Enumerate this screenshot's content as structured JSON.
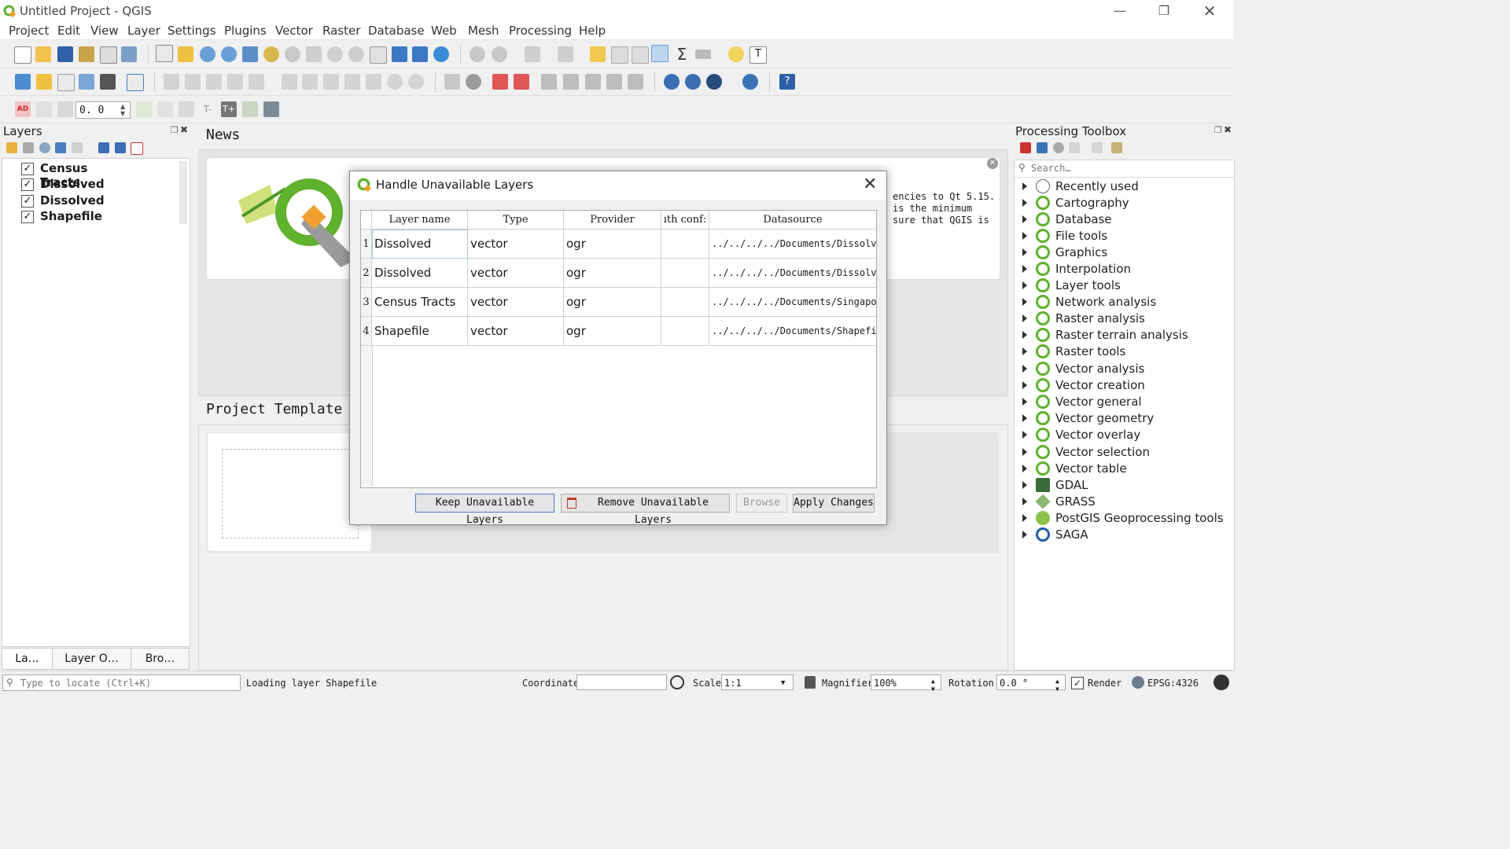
{
  "window": {
    "title": "Untitled Project - QGIS"
  },
  "menu": [
    "Project",
    "Edit",
    "View",
    "Layer",
    "Settings",
    "Plugins",
    "Vector",
    "Raster",
    "Database",
    "Web",
    "Mesh",
    "Processing",
    "Help"
  ],
  "toolbar3": {
    "spin_value": "0. 0"
  },
  "layers_panel": {
    "title": "Layers",
    "layers": [
      {
        "name": "Census Tracts",
        "checked": true
      },
      {
        "name": "Dissolved",
        "checked": true
      },
      {
        "name": "Dissolved",
        "checked": true
      },
      {
        "name": "Shapefile",
        "checked": true
      }
    ],
    "tabs": [
      "La…",
      "Layer O…",
      "Bro…"
    ]
  },
  "center": {
    "news_title": "News",
    "news_text": [
      "encies to Qt 5.15.",
      "is the minimum",
      "sure that QGIS is"
    ],
    "templates_title": "Project Template"
  },
  "toolbox": {
    "title": "Processing Toolbox",
    "search_placeholder": "Search…",
    "items": [
      "Recently used",
      "Cartography",
      "Database",
      "File tools",
      "Graphics",
      "Interpolation",
      "Layer tools",
      "Network analysis",
      "Raster analysis",
      "Raster terrain analysis",
      "Raster tools",
      "Vector analysis",
      "Vector creation",
      "Vector general",
      "Vector geometry",
      "Vector overlay",
      "Vector selection",
      "Vector table",
      "GDAL",
      "GRASS",
      "PostGIS Geoprocessing tools",
      "SAGA"
    ]
  },
  "dialog": {
    "title": "Handle Unavailable Layers",
    "columns": [
      "Layer name",
      "Type",
      "Provider",
      "ıth conf:",
      "Datasource"
    ],
    "rows": [
      {
        "num": "1",
        "name": "Dissolved",
        "type": "vector",
        "provider": "ogr",
        "auth": "",
        "datasource": "../../../../Documents/Dissolved"
      },
      {
        "num": "2",
        "name": "Dissolved",
        "type": "vector",
        "provider": "ogr",
        "auth": "",
        "datasource": "../../../../Documents/Dissolved"
      },
      {
        "num": "3",
        "name": "Census Tracts",
        "type": "vector",
        "provider": "ogr",
        "auth": "",
        "datasource": "../../../../Documents/Singapore"
      },
      {
        "num": "4",
        "name": "Shapefile",
        "type": "vector",
        "provider": "ogr",
        "auth": "",
        "datasource": "../../../../Documents/Shapefile"
      }
    ],
    "buttons": {
      "keep": "Keep Unavailable Layers",
      "remove": "Remove Unavailable Layers",
      "browse": "Browse",
      "apply": "Apply Changes"
    }
  },
  "statusbar": {
    "locate_placeholder": "Type to locate (Ctrl+K)",
    "message": "Loading layer Shapefile",
    "coordinate_label": "Coordinate",
    "coordinate_value": "",
    "scale_label": "Scale",
    "scale_value": "1:1",
    "magnifier_label": "Magnifier",
    "magnifier_value": "100%",
    "rotation_label": "Rotation",
    "rotation_value": "0.0 °",
    "render_label": "Render",
    "crs": "EPSG:4326"
  },
  "colors": {
    "qgis_green": "#5fb12e",
    "accent_blue": "#3d7ecb"
  }
}
